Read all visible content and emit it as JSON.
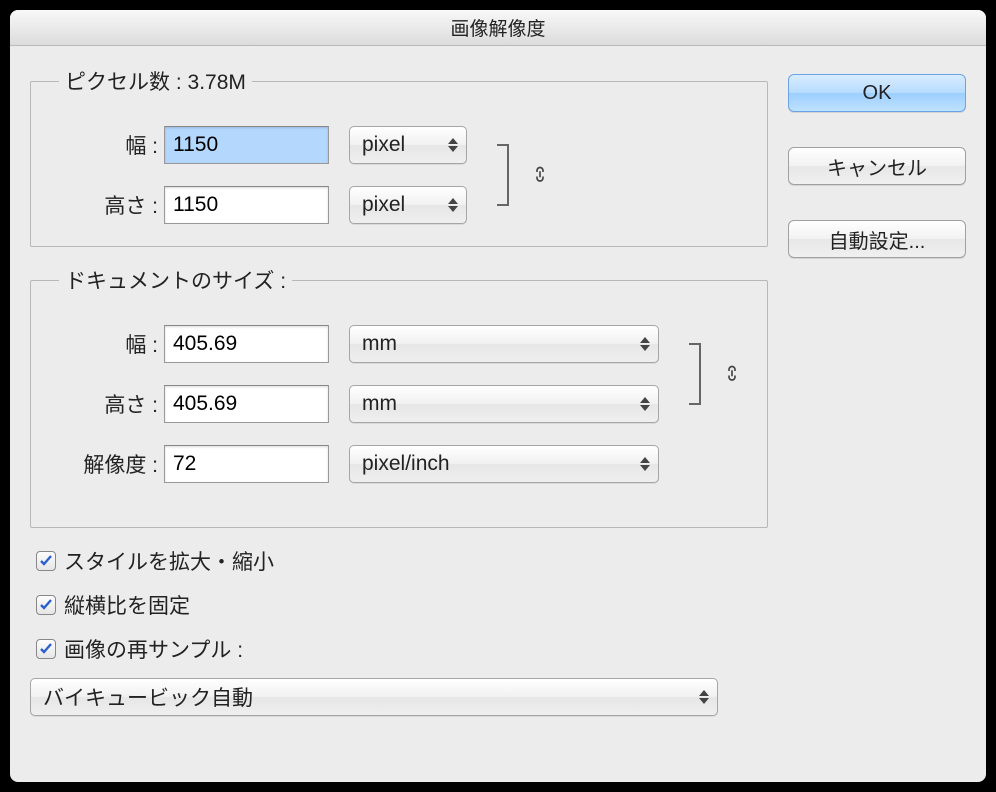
{
  "window": {
    "title": "画像解像度"
  },
  "pixel": {
    "legend_prefix": "ピクセル数 : ",
    "size": "3.78M",
    "width_label": "幅 :",
    "width_value": "1150",
    "width_unit": "pixel",
    "height_label": "高さ :",
    "height_value": "1150",
    "height_unit": "pixel"
  },
  "doc": {
    "legend": "ドキュメントのサイズ :",
    "width_label": "幅 :",
    "width_value": "405.69",
    "width_unit": "mm",
    "height_label": "高さ :",
    "height_value": "405.69",
    "height_unit": "mm",
    "res_label": "解像度 :",
    "res_value": "72",
    "res_unit": "pixel/inch"
  },
  "checks": {
    "scale_styles": "スタイルを拡大・縮小",
    "constrain": "縦横比を固定",
    "resample": "画像の再サンプル :"
  },
  "resample_method": "バイキュービック自動",
  "buttons": {
    "ok": "OK",
    "cancel": "キャンセル",
    "auto": "自動設定..."
  }
}
